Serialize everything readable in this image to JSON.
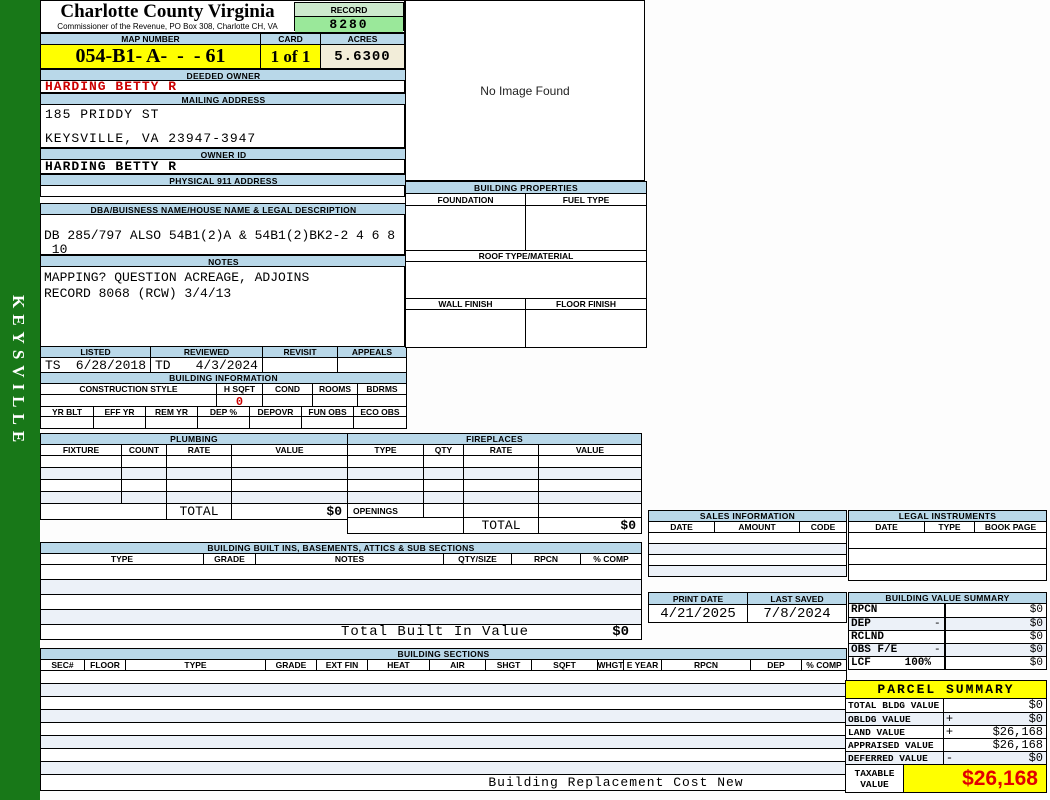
{
  "colors": {
    "band_blue": "#b9d8e9",
    "highlight_yellow": "#ffff00",
    "record_green": "#9ae89a",
    "record_header_green": "#cde9cd",
    "acres_cream": "#f2edd9",
    "sidebar_green": "#187818",
    "alert_red": "#cc0000",
    "taxable_red": "#e10000",
    "stripe_blue": "#ecf1f8"
  },
  "sidebar": {
    "district": "KEYSVILLE"
  },
  "header": {
    "county": "Charlotte County Virginia",
    "office": "Commissioner of the Revenue, PO Box 308, Charlotte CH, VA",
    "record_label": "RECORD",
    "record_number": "8280",
    "map_number_label": "MAP NUMBER",
    "map_number": "054-B1- A-  -  - 61",
    "card_label": "CARD",
    "card": "1 of 1",
    "acres_label": "ACRES",
    "acres": "5.6300"
  },
  "owner": {
    "deeded_owner_label": "DEEDED OWNER",
    "deeded_owner": "HARDING BETTY R",
    "mailing_address_label": "MAILING ADDRESS",
    "mailing_line1": "185 PRIDDY ST",
    "mailing_line2": "KEYSVILLE, VA 23947-3947",
    "owner_id_label": "OWNER ID",
    "owner_id": "HARDING BETTY R",
    "physical_911_label": "PHYSICAL 911 ADDRESS"
  },
  "legal_description": {
    "label": "DBA/BUISNESS NAME/HOUSE NAME & LEGAL DESCRIPTION",
    "line1": "DB 285/797 ALSO 54B1(2)A & 54B1(2)BK2-2 4 6 8",
    "line2": " 10"
  },
  "notes": {
    "label": "NOTES",
    "line1": "MAPPING? QUESTION ACREAGE, ADJOINS",
    "line2": "RECORD 8068 (RCW) 3/4/13"
  },
  "review": {
    "listed_label": "LISTED",
    "listed_initials": "TS",
    "listed_date": "6/28/2018",
    "reviewed_label": "REVIEWED",
    "reviewed_initials": "TD",
    "reviewed_date": "4/3/2024",
    "revisit_label": "REVISIT",
    "appeals_label": "APPEALS"
  },
  "building_information": {
    "label": "BUILDING INFORMATION",
    "row1_headers": [
      "CONSTRUCTION STYLE",
      "H SQFT",
      "COND",
      "ROOMS",
      "BDRMS"
    ],
    "h_sqft": "0",
    "row2_headers": [
      "YR BLT",
      "EFF YR",
      "REM YR",
      "DEP %",
      "DEPOVR",
      "FUN OBS",
      "ECO OBS"
    ]
  },
  "image_panel": {
    "placeholder": "No Image Found"
  },
  "building_properties": {
    "label": "BUILDING PROPERTIES",
    "foundation_label": "FOUNDATION",
    "fuel_type_label": "FUEL TYPE",
    "roof_label": "ROOF TYPE/MATERIAL",
    "wall_finish_label": "WALL FINISH",
    "floor_finish_label": "FLOOR FINISH"
  },
  "plumbing": {
    "label": "PLUMBING",
    "headers": [
      "FIXTURE",
      "COUNT",
      "RATE",
      "VALUE"
    ],
    "total_label": "TOTAL",
    "total_value": "$0"
  },
  "fireplaces": {
    "label": "FIREPLACES",
    "headers": [
      "TYPE",
      "QTY",
      "RATE",
      "VALUE"
    ],
    "openings_label": "OPENINGS",
    "total_label": "TOTAL",
    "total_value": "$0"
  },
  "built_ins": {
    "label": "BUILDING BUILT INS, BASEMENTS, ATTICS & SUB SECTIONS",
    "headers": [
      "TYPE",
      "GRADE",
      "NOTES",
      "QTY/SIZE",
      "RPCN",
      "% COMP"
    ],
    "total_label": "Total Built In Value",
    "total_value": "$0"
  },
  "building_sections": {
    "label": "BUILDING SECTIONS",
    "headers": [
      "SEC#",
      "FLOOR",
      "TYPE",
      "GRADE",
      "EXT FIN",
      "HEAT",
      "AIR",
      "SHGT",
      "SQFT",
      "WHGT",
      "E YEAR",
      "RPCN",
      "DEP",
      "% COMP"
    ],
    "footer": "Building Replacement Cost New"
  },
  "sales_information": {
    "label": "SALES INFORMATION",
    "headers": [
      "DATE",
      "AMOUNT",
      "CODE"
    ]
  },
  "legal_instruments": {
    "label": "LEGAL INSTRUMENTS",
    "headers": [
      "DATE",
      "TYPE",
      "BOOK PAGE"
    ]
  },
  "dates": {
    "print_date_label": "PRINT DATE",
    "print_date": "4/21/2025",
    "last_saved_label": "LAST SAVED",
    "last_saved": "7/8/2024"
  },
  "building_value_summary": {
    "label": "BUILDING VALUE SUMMARY",
    "rows": [
      {
        "label": "RPCN",
        "op": "",
        "value": "$0"
      },
      {
        "label": "DEP",
        "op": "-",
        "value": "$0"
      },
      {
        "label": "RCLND",
        "op": "",
        "value": "$0"
      },
      {
        "label": "OBS F/E",
        "op": "-",
        "value": "$0"
      },
      {
        "label": "LCF",
        "pct": "100%",
        "op": "",
        "value": "$0"
      }
    ]
  },
  "parcel_summary": {
    "label": "PARCEL SUMMARY",
    "rows": [
      {
        "label": "TOTAL BLDG VALUE",
        "op": "",
        "value": "$0"
      },
      {
        "label": "OBLDG VALUE",
        "op": "+",
        "value": "$0"
      },
      {
        "label": "LAND VALUE",
        "op": "+",
        "value": "$26,168"
      },
      {
        "label": "APPRAISED VALUE",
        "op": "",
        "value": "$26,168"
      },
      {
        "label": "DEFERRED VALUE",
        "op": "-",
        "value": "$0"
      }
    ],
    "taxable_label_line1": "TAXABLE",
    "taxable_label_line2": "VALUE",
    "taxable_value": "$26,168"
  }
}
